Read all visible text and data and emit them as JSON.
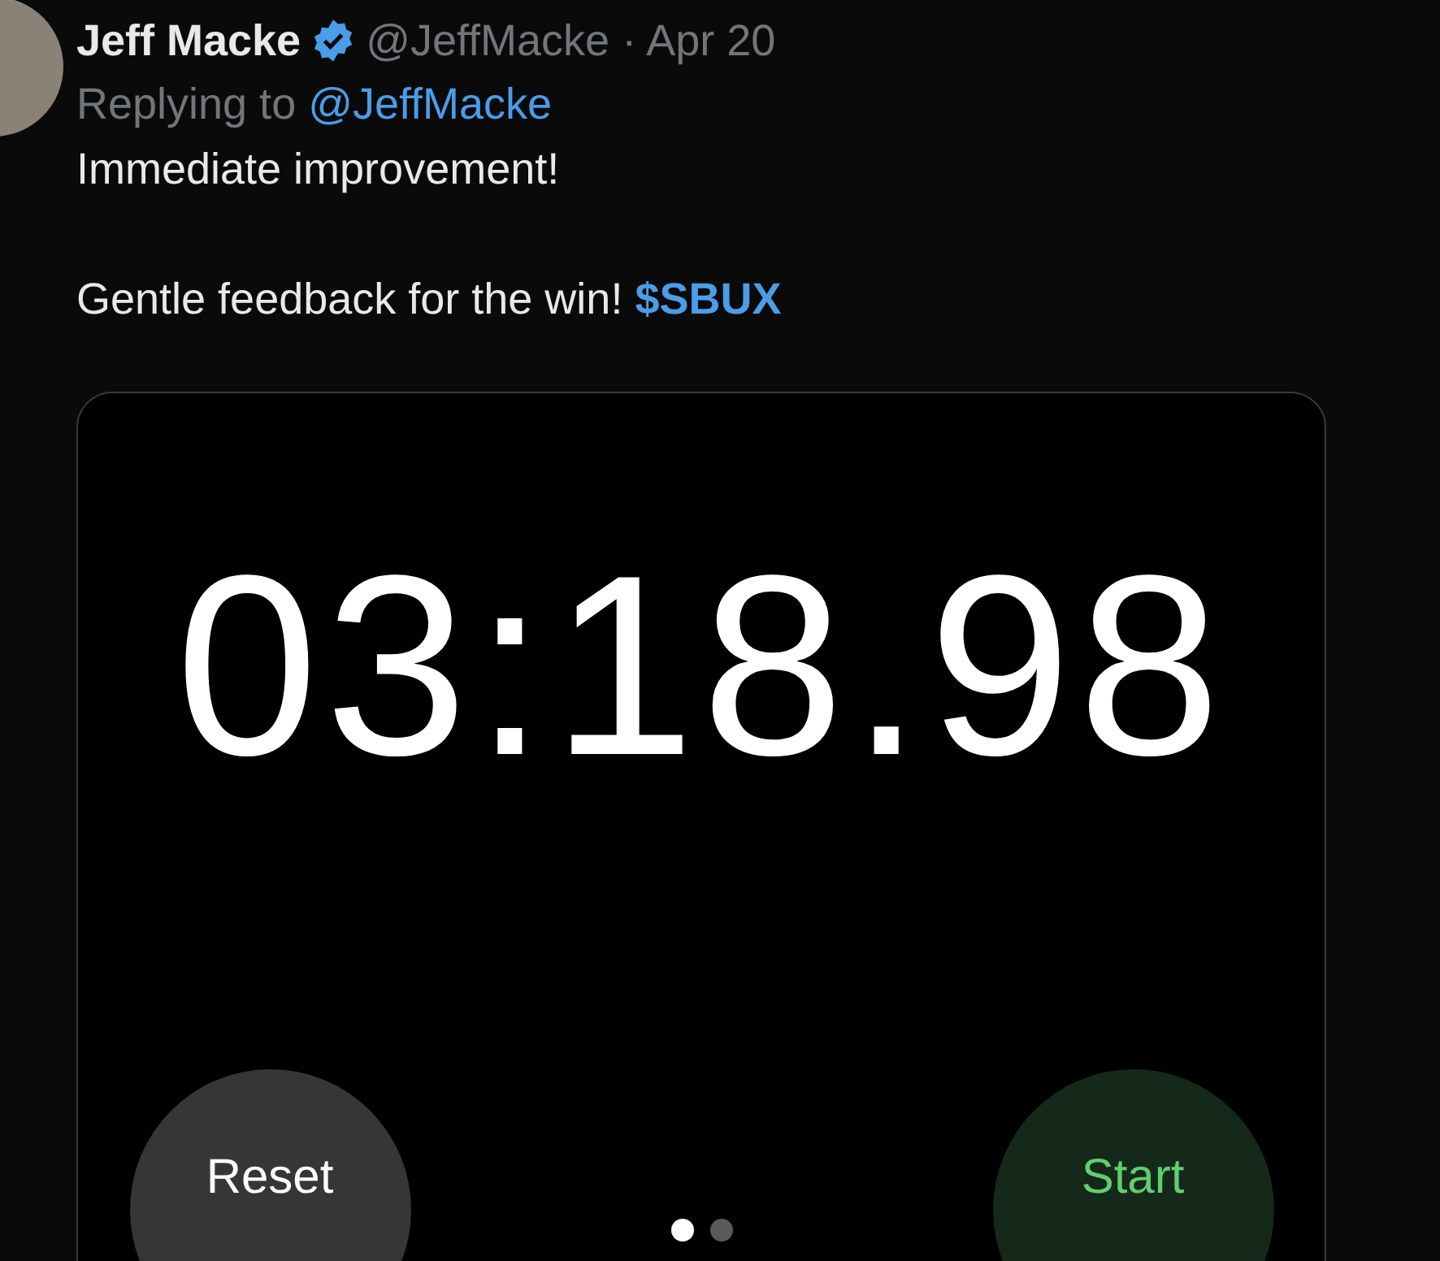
{
  "tweet": {
    "author": {
      "name": "Jeff Macke",
      "verified": true,
      "handle": "@JeffMacke",
      "separator": "·",
      "date": "Apr 20"
    },
    "replying_to": {
      "label": "Replying to",
      "handle": "@JeffMacke"
    },
    "text": [
      "Immediate improvement!",
      "Gentle feedback for the win!"
    ],
    "cashtag": "$SBUX",
    "media": {
      "time": "03:18.98",
      "buttons": [
        {
          "label": "Reset",
          "kind": "reset"
        },
        {
          "label": "Start",
          "kind": "start"
        }
      ],
      "page_dots": [
        {
          "selected": true
        },
        {
          "selected": false
        }
      ]
    }
  }
}
